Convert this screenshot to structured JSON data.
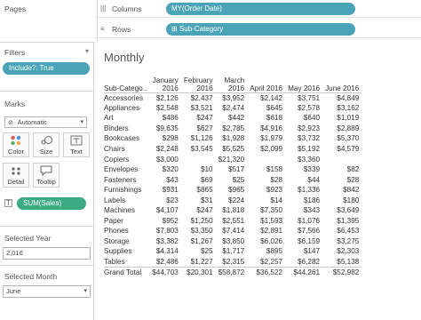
{
  "left": {
    "pages_title": "Pages",
    "filters_title": "Filters",
    "filter_pill": "Include?: True",
    "marks_title": "Marks",
    "mark_type": "Automatic",
    "mark_buttons": [
      {
        "label": "Color",
        "icon": "color-dots-icon"
      },
      {
        "label": "Size",
        "icon": "size-icon"
      },
      {
        "label": "Text",
        "icon": "text-icon"
      },
      {
        "label": "Detail",
        "icon": "detail-icon"
      },
      {
        "label": "Tooltip",
        "icon": "tooltip-icon"
      }
    ],
    "measure_pill": "SUM(Sales)",
    "year_title": "Selected Year",
    "year_value": "2,016",
    "month_title": "Selected Month",
    "month_value": "June"
  },
  "shelves": {
    "columns_label": "Columns",
    "columns_pill": "MY(Order Date)",
    "rows_label": "Rows",
    "rows_pill": "Sub-Category"
  },
  "view": {
    "title": "Monthly",
    "row_header": "Sub-Catego..",
    "columns": [
      [
        "January",
        "2016"
      ],
      [
        "February",
        "2016"
      ],
      [
        "March",
        "2016"
      ],
      [
        "April 2016",
        ""
      ],
      [
        "May 2016",
        ""
      ],
      [
        "June 2016",
        ""
      ]
    ],
    "rows": [
      {
        "name": "Accessories",
        "v": [
          "$2,126",
          "$2,437",
          "$3,952",
          "$2,142",
          "$3,751",
          "$4,849"
        ]
      },
      {
        "name": "Appliances",
        "v": [
          "$2,548",
          "$3,521",
          "$2,474",
          "$645",
          "$2,578",
          "$3,162"
        ]
      },
      {
        "name": "Art",
        "v": [
          "$486",
          "$247",
          "$442",
          "$618",
          "$640",
          "$1,019"
        ]
      },
      {
        "name": "Binders",
        "v": [
          "$9,635",
          "$627",
          "$2,785",
          "$4,916",
          "$2,923",
          "$2,889"
        ]
      },
      {
        "name": "Bookcases",
        "v": [
          "$298",
          "$1,126",
          "$1,928",
          "$1,979",
          "$3,732",
          "$5,370"
        ]
      },
      {
        "name": "Chairs",
        "v": [
          "$2,248",
          "$3,545",
          "$5,525",
          "$2,099",
          "$5,192",
          "$4,579"
        ]
      },
      {
        "name": "Copiers",
        "v": [
          "$3,000",
          "",
          "$21,320",
          "",
          "$3,360",
          ""
        ]
      },
      {
        "name": "Envelopes",
        "v": [
          "$320",
          "$10",
          "$517",
          "$158",
          "$339",
          "$82"
        ]
      },
      {
        "name": "Fasteners",
        "v": [
          "$43",
          "$69",
          "$25",
          "$28",
          "$44",
          "$28"
        ]
      },
      {
        "name": "Furnishings",
        "v": [
          "$931",
          "$865",
          "$965",
          "$923",
          "$1,336",
          "$842"
        ]
      },
      {
        "name": "Labels",
        "v": [
          "$23",
          "$31",
          "$224",
          "$14",
          "$186",
          "$180"
        ]
      },
      {
        "name": "Machines",
        "v": [
          "$4,107",
          "$247",
          "$1,818",
          "$7,350",
          "$343",
          "$3,649"
        ]
      },
      {
        "name": "Paper",
        "v": [
          "$952",
          "$1,250",
          "$2,551",
          "$1,593",
          "$1,076",
          "$1,395"
        ]
      },
      {
        "name": "Phones",
        "v": [
          "$7,803",
          "$3,350",
          "$7,414",
          "$2,891",
          "$7,566",
          "$6,453"
        ]
      },
      {
        "name": "Storage",
        "v": [
          "$3,382",
          "$1,267",
          "$3,850",
          "$6,026",
          "$6,159",
          "$3,275"
        ]
      },
      {
        "name": "Supplies",
        "v": [
          "$4,314",
          "$25",
          "$1,717",
          "$895",
          "$147",
          "$2,303"
        ]
      },
      {
        "name": "Tables",
        "v": [
          "$2,486",
          "$1,227",
          "$2,315",
          "$2,257",
          "$6,282",
          "$5,138"
        ]
      }
    ],
    "total": {
      "name": "Grand Total",
      "v": [
        "$44,703",
        "$20,301",
        "$58,872",
        "$36,522",
        "$44,261",
        "$52,982"
      ]
    }
  }
}
